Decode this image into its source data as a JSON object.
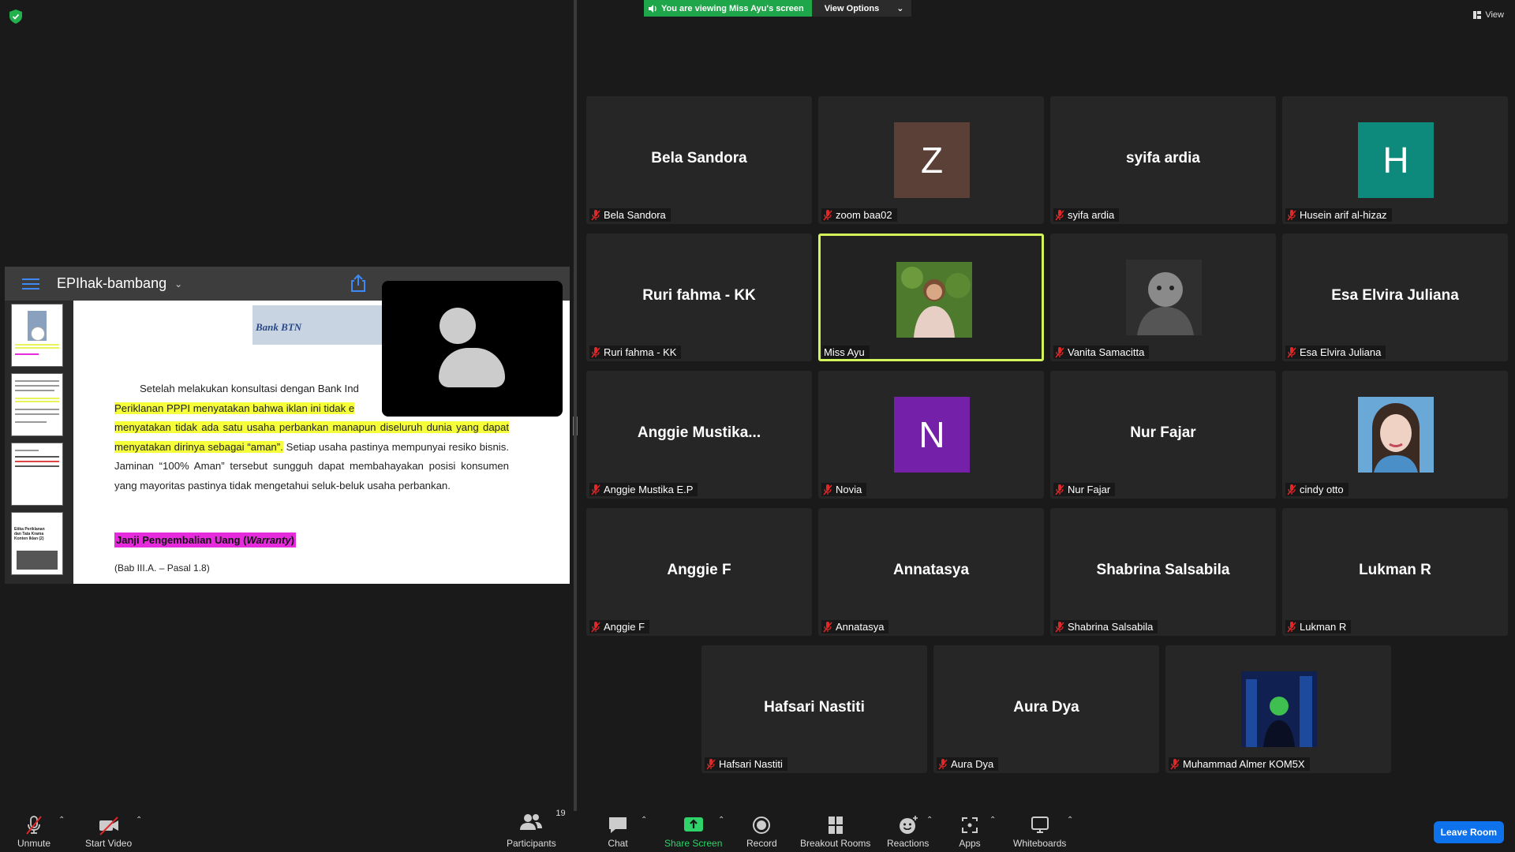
{
  "top": {
    "viewing_text": "You are viewing Miss Ayu's screen",
    "view_options": "View Options",
    "view_label": "View"
  },
  "shared_doc": {
    "title": "EPIhak-bambang",
    "logo_text": "Bank BTN",
    "para_lead": "Setelah melakukan konsultasi dengan Bank Ind",
    "para_hl1": "Periklanan PPPI menyatakan bahwa iklan ini tidak e",
    "para_hl2": "menyatakan tidak ada satu usaha perbankan manapun diseluruh dunia yang dapat menyatakan dirinya sebagai “aman”.",
    "para_rest": " Setiap usaha pastinya mempunyai resiko bisnis. Jaminan “100% Aman” tersebut sungguh dapat membahayakan posisi konsumen yang mayoritas pastinya tidak mengetahui seluk-beluk usaha perbankan.",
    "heading_main": "Janji Pengembalian Uang (",
    "heading_italic": "Warranty",
    "heading_end": ")",
    "reference": "(Bab III.A. – Pasal 1.8)",
    "thumb_text": "Etika Periklanan dan Tata Krama Konten Iklan (2)"
  },
  "participants": [
    {
      "name": "Bela Sandora",
      "display": "Bela Sandora",
      "type": "name"
    },
    {
      "name": "zoom baa02",
      "display": "Z",
      "type": "avatar",
      "color": "#5b4038"
    },
    {
      "name": "syifa ardia",
      "display": "syifa ardia",
      "type": "name"
    },
    {
      "name": "Husein arif al-hizaz",
      "display": "H",
      "type": "avatar",
      "color": "#0e8a7c"
    },
    {
      "name": "Ruri fahma - KK",
      "display": "Ruri fahma - KK",
      "type": "name"
    },
    {
      "name": "Miss Ayu",
      "display": "",
      "type": "photo"
    },
    {
      "name": "Vanita Samacitta",
      "display": "",
      "type": "photo"
    },
    {
      "name": "Esa Elvira Juliana",
      "display": "Esa Elvira Juliana",
      "type": "name"
    },
    {
      "name": "Anggie Mustika E.P",
      "display": "Anggie  Mustika...",
      "type": "name"
    },
    {
      "name": "Novia",
      "display": "N",
      "type": "avatar",
      "color": "#7420a8"
    },
    {
      "name": "Nur Fajar",
      "display": "Nur Fajar",
      "type": "name"
    },
    {
      "name": "cindy otto",
      "display": "",
      "type": "photo"
    },
    {
      "name": "Anggie F",
      "display": "Anggie F",
      "type": "name"
    },
    {
      "name": "Annatasya",
      "display": "Annatasya",
      "type": "name"
    },
    {
      "name": "Shabrina Salsabila",
      "display": "Shabrina Salsabila",
      "type": "name"
    },
    {
      "name": "Lukman R",
      "display": "Lukman R",
      "type": "name"
    },
    {
      "name": "Hafsari Nastiti",
      "display": "Hafsari Nastiti",
      "type": "name"
    },
    {
      "name": "Aura Dya",
      "display": "Aura Dya",
      "type": "name"
    },
    {
      "name": "Muhammad Almer KOM5X",
      "display": "",
      "type": "photo"
    }
  ],
  "toolbar": {
    "unmute": "Unmute",
    "start_video": "Start Video",
    "participants": "Participants",
    "participants_count": "19",
    "chat": "Chat",
    "share_screen": "Share Screen",
    "record": "Record",
    "breakout_rooms": "Breakout Rooms",
    "reactions": "Reactions",
    "apps": "Apps",
    "whiteboards": "Whiteboards",
    "leave": "Leave Room"
  },
  "colors": {
    "active_speaker_border": "#d3f55a",
    "share_green": "#1fa64a",
    "leave_blue": "#0e72ed",
    "muted_red": "#e02828"
  }
}
